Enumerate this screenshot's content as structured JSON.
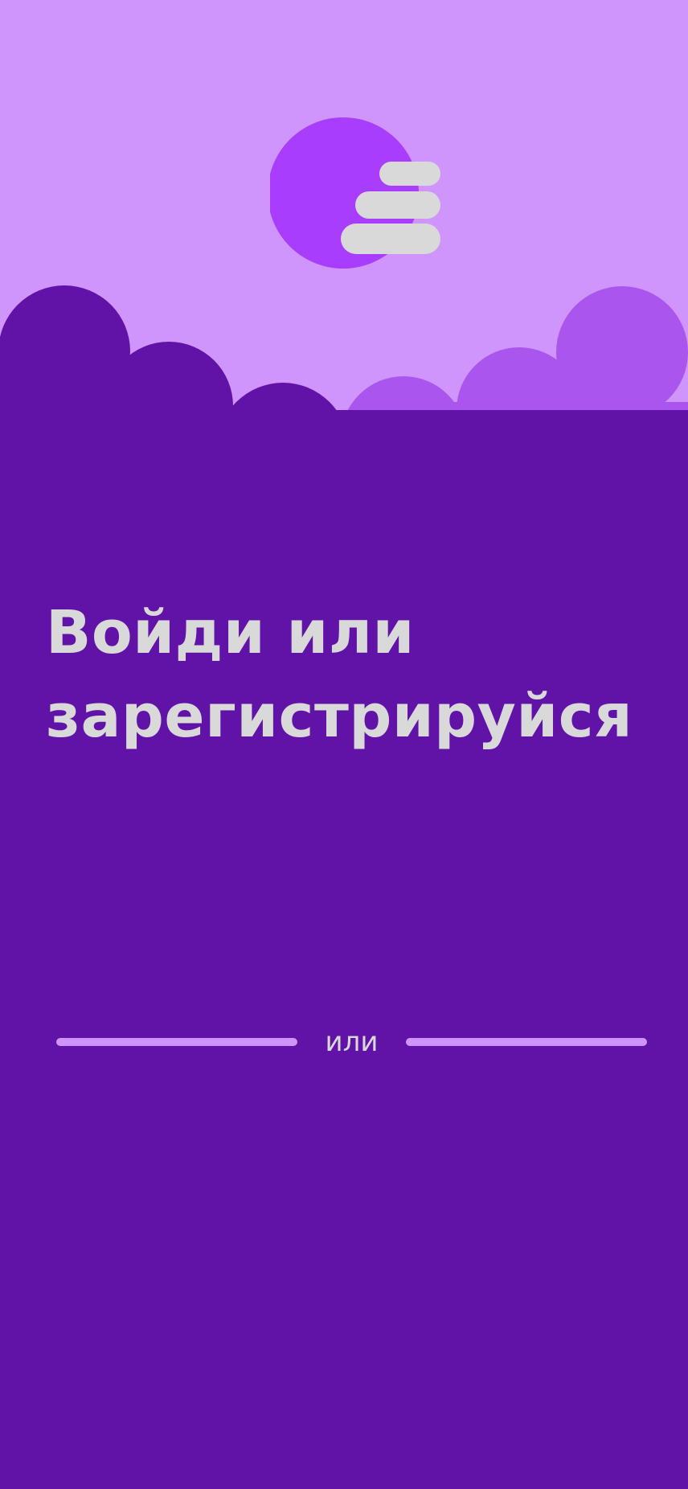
{
  "colors": {
    "sky": "#CF95FD",
    "cloud_back": "#AA55EE",
    "cloud_front": "#6113A8",
    "sun": "#A93DFD",
    "logo_bars": "#D9D9D9",
    "text": "#D9D9D9",
    "divider": "#CF95FD"
  },
  "logo": {
    "icon": "stacked-bars-logo-icon"
  },
  "headline": {
    "line1": "Войди или",
    "line2": "зарегистрируйся"
  },
  "divider": {
    "label": "или"
  }
}
